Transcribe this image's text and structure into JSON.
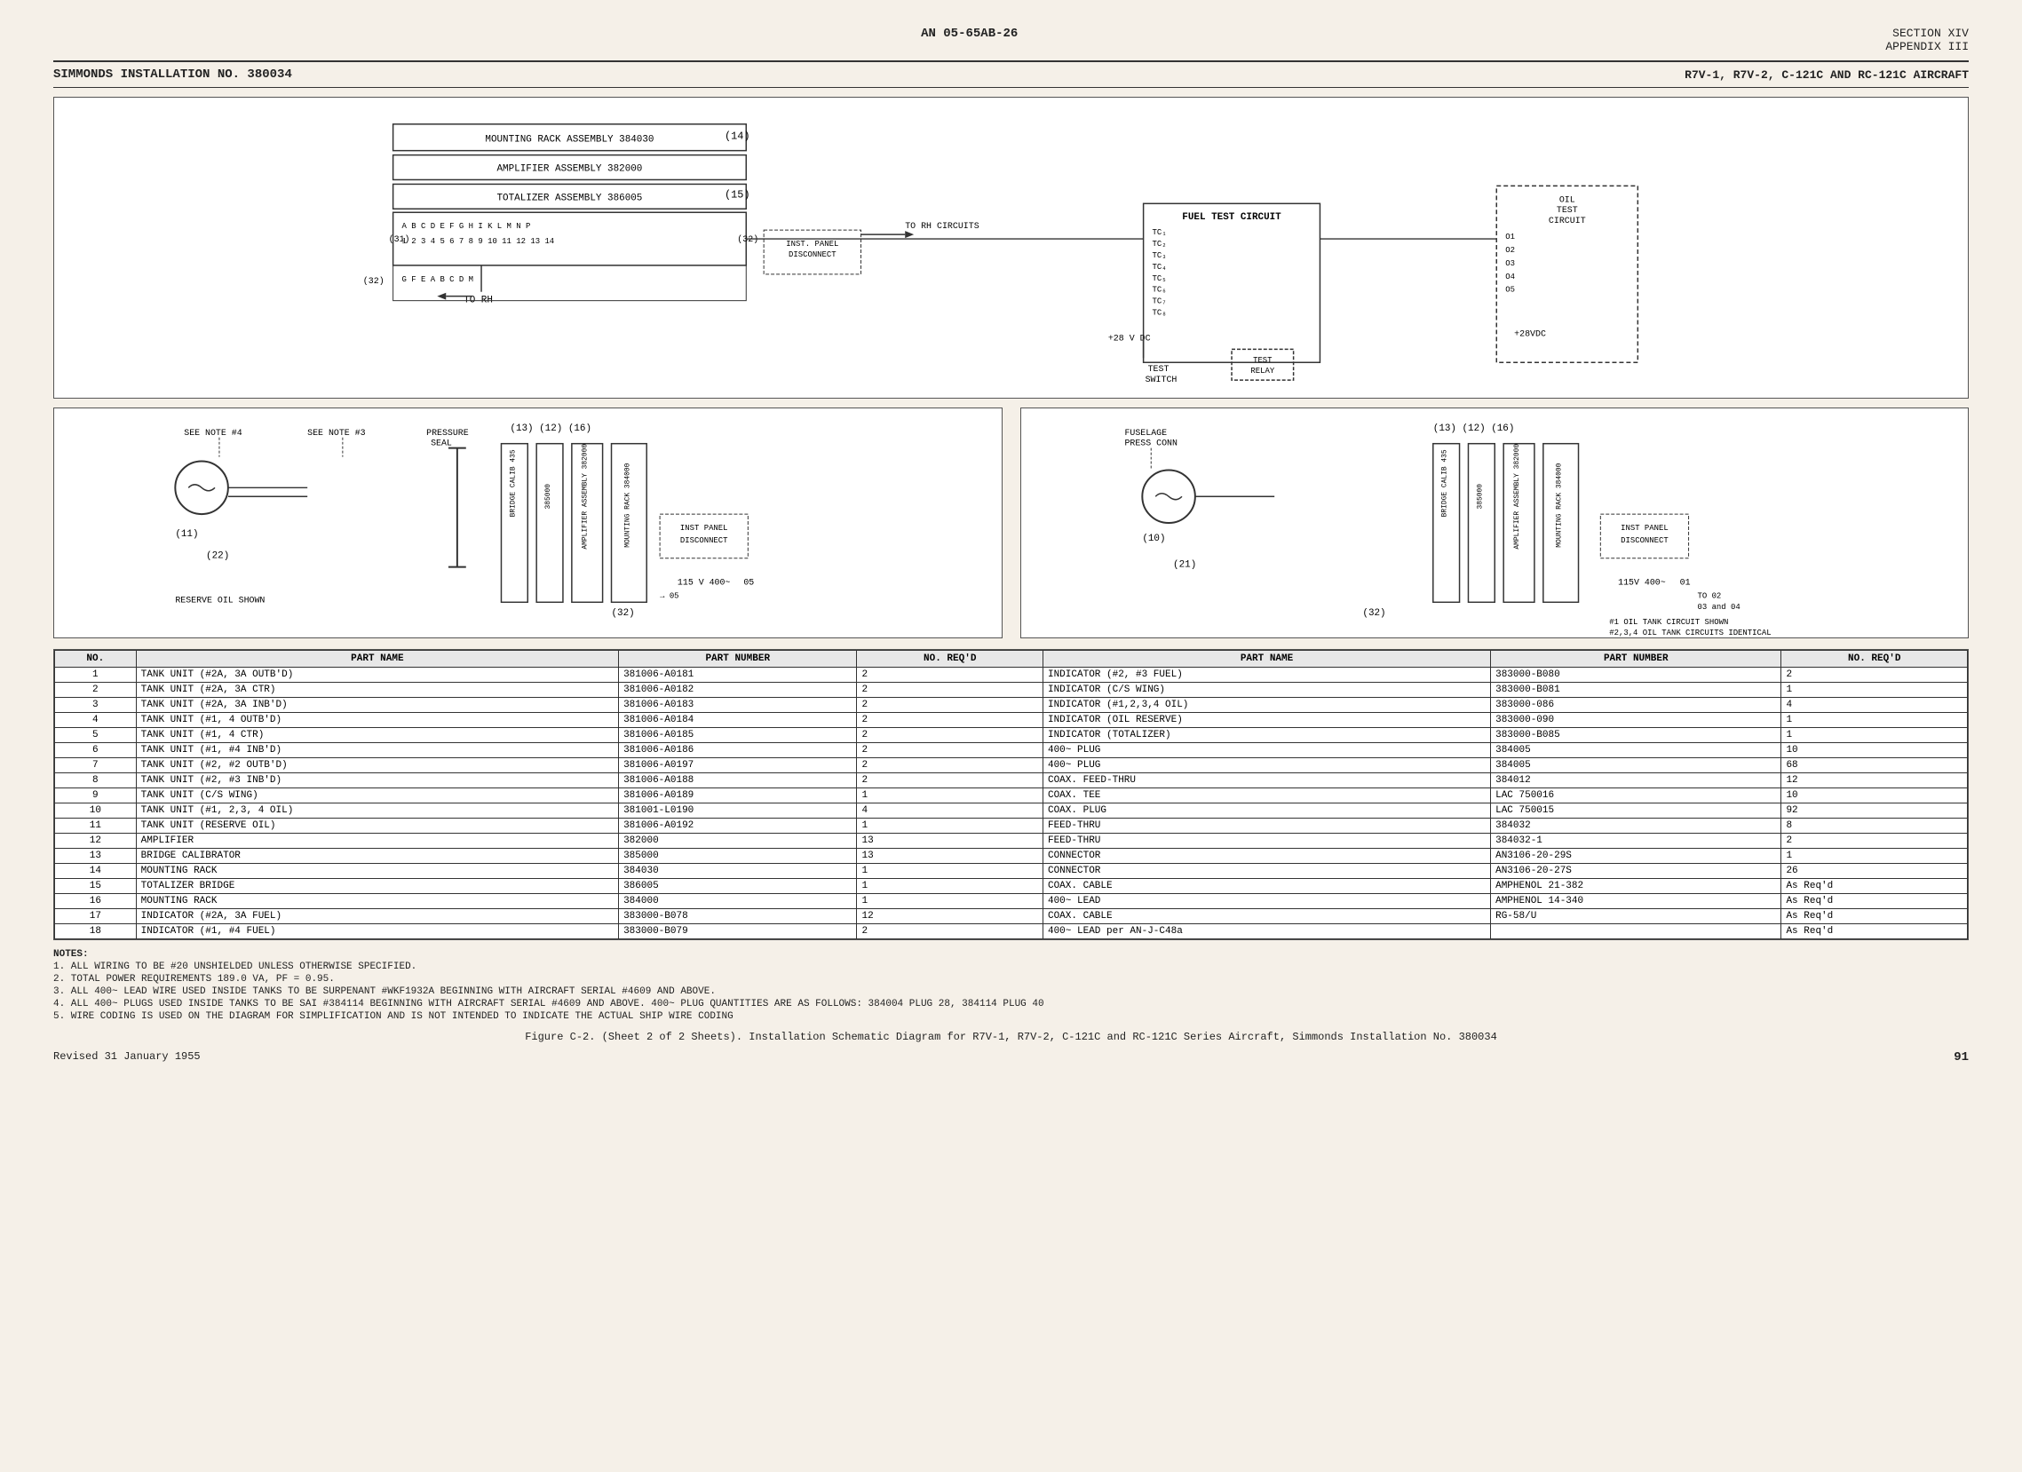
{
  "header": {
    "doc_number": "AN 05-65AB-26",
    "section": "SECTION XIV",
    "appendix": "APPENDIX III",
    "installation": "SIMMONDS INSTALLATION NO. 380034",
    "aircraft": "R7V-1, R7V-2, C-121C AND RC-121C AIRCRAFT"
  },
  "diagram": {
    "title": "FUEL TEST CIRCUIT",
    "test_switch_label": "TEST switch",
    "components": {
      "mounting_rack": "MOUNTING RACK ASSEMBLY 384030",
      "amplifier": "AMPLIFIER ASSEMBLY 382000",
      "totalizer": "TOTALIZER ASSEMBLY 386005",
      "inst_panel": "INST. PANEL DISCONNECT",
      "to_rh": "TO RH",
      "to_rh_circuits": "TO RH CIRCUITS",
      "fuel_test_circuit": "FUEL TEST CIRCUIT",
      "test_switch": "TEST SWITCH",
      "test_relay": "TEST RELAY",
      "oil_test_circuit": "OIL TEST CIRCUIT",
      "voltage1": "+28 V DC",
      "voltage2": "+28VDC",
      "pressure_seal": "PRESSURE SEAL",
      "reserve_oil": "RESERVE OIL SHOWN",
      "inst_panel_disconnect": "INST PANEL DISCONNECT",
      "voltage3": "115 V 400~",
      "oil_tank1": "#1 OIL TANK CIRCUIT SHOWN",
      "oil_tank2": "#2,3,4 OIL TANK CIRCUITS IDENTICAL",
      "fuselage_press": "FUSELAGE PRESS CONN",
      "voltage4": "115V 400~",
      "to_02": "TO 02",
      "to_03_04": "03 and 04",
      "see_note3": "SEE NOTE #3",
      "see_note4": "SEE NOTE #4"
    }
  },
  "parts_table": {
    "columns": [
      "NO.",
      "PART NAME",
      "PART NUMBER",
      "NO. REQ'D",
      "PART NAME",
      "PART NUMBER",
      "NO. REQ'D"
    ],
    "rows": [
      [
        1,
        "TANK UNIT (#2A, 3A OUTB'D)",
        "381006-A0181",
        2,
        "INDICATOR (#2, #3 FUEL)",
        "383000-B080",
        2
      ],
      [
        2,
        "TANK UNIT (#2A, 3A CTR)",
        "381006-A0182",
        2,
        "INDICATOR (C/S WING)",
        "383000-B081",
        1
      ],
      [
        3,
        "TANK UNIT (#2A, 3A INB'D)",
        "381006-A0183",
        2,
        "INDICATOR (#1,2,3,4 OIL)",
        "383000-086",
        4
      ],
      [
        4,
        "TANK UNIT (#1, 4 OUTB'D)",
        "381006-A0184",
        2,
        "INDICATOR (OIL RESERVE)",
        "383000-090",
        1
      ],
      [
        5,
        "TANK UNIT (#1, 4 CTR)",
        "381006-A0185",
        2,
        "INDICATOR (TOTALIZER)",
        "383000-B085",
        1
      ],
      [
        6,
        "TANK UNIT (#1, #4 INB'D)",
        "381006-A0186",
        2,
        "400~ PLUG",
        "384005",
        10
      ],
      [
        7,
        "TANK UNIT (#2, #2 OUTB'D)",
        "381006-A0197",
        2,
        "400~ PLUG",
        "384005",
        68
      ],
      [
        8,
        "TANK UNIT (#2, #3 INB'D)",
        "381006-A0188",
        2,
        "COAX. FEED-THRU",
        "384012",
        12
      ],
      [
        9,
        "TANK UNIT (C/S WING)",
        "381006-A0189",
        1,
        "COAX. TEE",
        "LAC 750016",
        10
      ],
      [
        10,
        "TANK UNIT (#1, 2,3, 4 OIL)",
        "381001-L0190",
        4,
        "COAX. PLUG",
        "LAC 750015",
        92
      ],
      [
        11,
        "TANK UNIT (RESERVE OIL)",
        "381006-A0192",
        1,
        "FEED-THRU",
        "384032",
        8
      ],
      [
        12,
        "AMPLIFIER",
        "382000",
        13,
        "FEED-THRU",
        "384032-1",
        2
      ],
      [
        13,
        "BRIDGE CALIBRATOR",
        "385000",
        13,
        "CONNECTOR",
        "AN3106-20-29S",
        1
      ],
      [
        14,
        "MOUNTING RACK",
        "384030",
        1,
        "CONNECTOR",
        "AN3106-20-27S",
        26
      ],
      [
        15,
        "TOTALIZER BRIDGE",
        "386005",
        1,
        "COAX. CABLE",
        "AMPHENOL 21-382",
        "As Req'd"
      ],
      [
        16,
        "MOUNTING RACK",
        "384000",
        1,
        "400~ LEAD",
        "AMPHENOL 14-340",
        "As Req'd"
      ],
      [
        17,
        "INDICATOR (#2A, 3A FUEL)",
        "383000-B078",
        12,
        "COAX. CABLE",
        "RG-58/U",
        "As Req'd"
      ],
      [
        18,
        "INDICATOR (#1, #4 FUEL)",
        "383000-B079",
        2,
        "400~ LEAD per AN-J-C48a",
        "",
        "As Req'd"
      ]
    ]
  },
  "notes": {
    "title": "NOTES:",
    "items": [
      "1. ALL WIRING TO BE #20 UNSHIELDED UNLESS OTHERWISE SPECIFIED.",
      "2. TOTAL POWER REQUIREMENTS 189.0 VA, PF = 0.95.",
      "3. ALL 400~ LEAD WIRE USED INSIDE TANKS TO BE SURPENANT #WKF1932A BEGINNING WITH AIRCRAFT SERIAL #4609 AND ABOVE.",
      "4. ALL 400~ PLUGS USED INSIDE TANKS TO BE SAI #384114 BEGINNING WITH AIRCRAFT SERIAL #4609 AND ABOVE. 400~ PLUG QUANTITIES ARE AS FOLLOWS: 384004 PLUG 28, 384114 PLUG 40",
      "5. WIRE CODING IS USED ON THE DIAGRAM FOR SIMPLIFICATION AND IS NOT INTENDED TO INDICATE THE ACTUAL SHIP WIRE CODING"
    ]
  },
  "figure_caption": "Figure C-2. (Sheet 2 of 2 Sheets). Installation Schematic Diagram for R7V-1, R7V-2, C-121C and RC-121C Series Aircraft, Simmonds Installation No. 380034",
  "footer": {
    "revised": "Revised 31 January 1955",
    "page": "91"
  }
}
